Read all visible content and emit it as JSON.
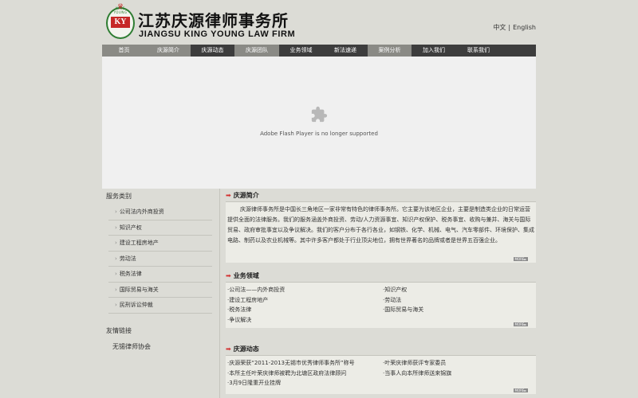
{
  "header": {
    "logo_letters": "KY",
    "logo_arc_text": "KING YOUNG",
    "brand_cn": "江苏庆源律师事务所",
    "brand_en": "JIANGSU KING YOUNG LAW FIRM",
    "lang_cn": "中文",
    "lang_sep": "|",
    "lang_en": "English"
  },
  "nav": {
    "items": [
      "首页",
      "庆源简介",
      "庆源动态",
      "庆源团队",
      "业务领域",
      "新法速递",
      "案例分析",
      "加入我们",
      "联系我们"
    ]
  },
  "flash": {
    "message": "Adobe Flash Player is no longer supported"
  },
  "sidebar": {
    "title": "服务类别",
    "items": [
      "公司法内外商投资",
      "知识产权",
      "建设工程房地产",
      "劳动法",
      "税务法律",
      "国际贸易与海关",
      "民刑诉讼仲裁"
    ],
    "links_title": "友情链接",
    "links": [
      "无锡律师协会"
    ]
  },
  "intro": {
    "title": "庆源简介",
    "text": "庆源律师事务所是中国长三角地区一家非常有特色的律师事务所。它主要为该地区企业，主要是制造类企业的日常运营提供全面的法律服务。我们的服务涵盖外商投资、劳动/人力资源事宜、知识产权保护、税务事宜、收购与兼并、海关与国际贸易、政府审批事宜以及争议解决。我们的客户分布于各行各业，如钢铁、化学、机械、电气、汽车零部件、环境保护、集成电路、制药以及农业机械等。其中许多客户都处于行业顶尖地位，拥有世界著名的品牌或者是世界五百强企业。",
    "more": "MORE►"
  },
  "areas": {
    "title": "业务领域",
    "items": [
      "·公司法——内外商投资",
      "·知识产权",
      "·建设工程房地产",
      "·劳动法",
      "·税务法律",
      "·国际贸易与海关",
      "·争议解决"
    ],
    "more": "MORE►"
  },
  "news": {
    "title": "庆源动态",
    "items": [
      "·庆源荣获“2011-2013无锡市优秀律师事务所”称号",
      "·叶荣庆律师获评专家委员",
      "·本所主任叶荣庆律师被聘为北塘区政府法律顾问",
      "·当事人向本所律师送来锦旗",
      "·3月9日隆重开业挂牌"
    ],
    "more": "MORE►"
  },
  "icons": {
    "section_arrow": "right-arrow-icon",
    "flash_plugin": "puzzle-piece-icon"
  },
  "colors": {
    "page_bg": "#dcdcd6",
    "nav_bg": "#3d3d3d",
    "nav_active_bg": "#8a8a85",
    "accent_red": "#d32f2f",
    "logo_green": "#2e7d32"
  }
}
